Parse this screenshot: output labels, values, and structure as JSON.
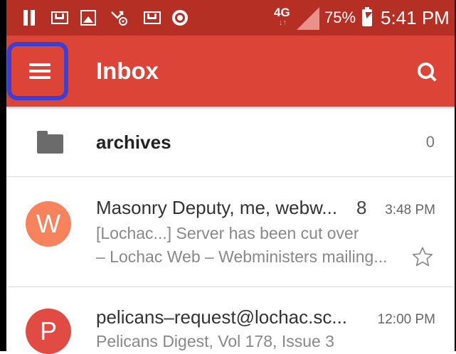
{
  "status_bar": {
    "network": "4G",
    "network_sub": "↓↑",
    "battery": "75%",
    "time": "5:41 PM",
    "icons": [
      "pause-icon",
      "gmail-icon",
      "gallery-icon",
      "missed-call-mail-icon",
      "gmail-icon",
      "chrome-icon",
      "signal-icon",
      "battery-charging-icon"
    ]
  },
  "app_bar": {
    "title": "Inbox",
    "menu_icon": "menu-icon",
    "search_icon": "search-icon",
    "color": "#db4437"
  },
  "folder": {
    "label": "archives",
    "count": "0",
    "icon": "folder-icon"
  },
  "emails": [
    {
      "avatar": "W",
      "avatar_color": "#f7835c",
      "sender": "Masonry Deputy, me, webw...",
      "count": "8",
      "time": "3:48 PM",
      "subject": "[Lochac...] Server has been cut over",
      "snippet": "– Lochac Web – Webministers mailing...",
      "starred": false
    },
    {
      "avatar": "P",
      "avatar_color": "#e04c43",
      "sender": "pelicans–request@lochac.sc...",
      "time": "12:00 PM",
      "subject": "Pelicans Digest, Vol 178, Issue 3"
    }
  ],
  "highlight_color": "#3b3fd6"
}
